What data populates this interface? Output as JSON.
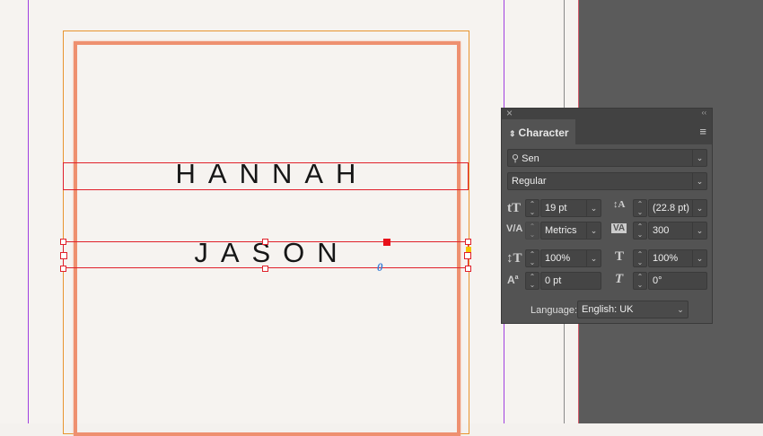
{
  "document": {
    "line1": "HANNAH",
    "line2": "JASON",
    "overset_marker": "0"
  },
  "panel": {
    "close": "×",
    "collapse": "‹‹",
    "title": "Character",
    "menu": "≡",
    "font_family": "Sen",
    "font_style": "Regular",
    "font_size": "19 pt",
    "leading": "(22.8 pt)",
    "kerning": "Metrics",
    "tracking": "300",
    "vertical_scale": "100%",
    "horizontal_scale": "100%",
    "baseline_shift": "0 pt",
    "skew": "0°",
    "language_label": "Language:",
    "language": "English: UK"
  }
}
